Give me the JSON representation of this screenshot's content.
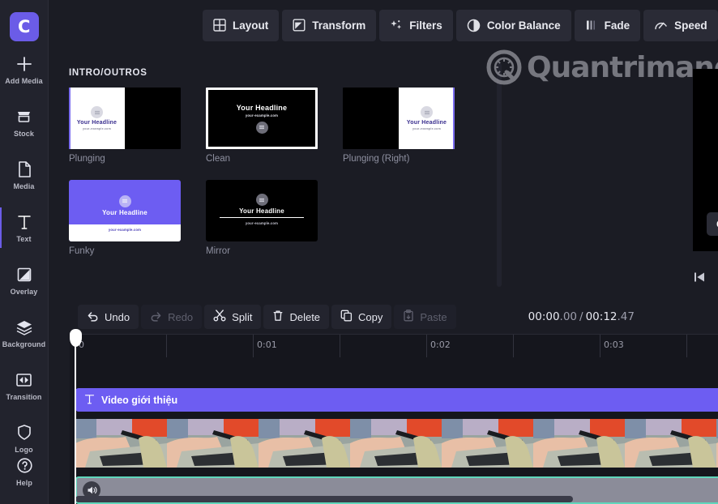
{
  "app": {
    "logo_letter": "C"
  },
  "sidebar": {
    "items": [
      {
        "label": "Add Media",
        "icon": "plus-icon",
        "active": false
      },
      {
        "label": "Stock",
        "icon": "stock-icon",
        "active": false
      },
      {
        "label": "Media",
        "icon": "media-file-icon",
        "active": false
      },
      {
        "label": "Text",
        "icon": "text-t-icon",
        "active": true
      },
      {
        "label": "Overlay",
        "icon": "overlay-icon",
        "active": false
      },
      {
        "label": "Background",
        "icon": "layers-icon",
        "active": false
      },
      {
        "label": "Transition",
        "icon": "transition-icon",
        "active": false
      },
      {
        "label": "Logo",
        "icon": "shield-icon",
        "active": false
      }
    ],
    "help": {
      "label": "Help",
      "icon": "question-circle-icon"
    }
  },
  "toolbar": {
    "buttons": [
      {
        "label": "Layout",
        "icon": "layout-grid-icon"
      },
      {
        "label": "Transform",
        "icon": "transform-icon"
      },
      {
        "label": "Filters",
        "icon": "sparkles-icon"
      },
      {
        "label": "Color Balance",
        "icon": "color-balance-icon"
      },
      {
        "label": "Fade",
        "icon": "fade-bars-icon"
      },
      {
        "label": "Speed",
        "icon": "speed-gauge-icon"
      }
    ],
    "volume_icon": "volume-icon"
  },
  "panel": {
    "title": "INTRO/OUTROS",
    "templates": [
      {
        "name": "Plunging",
        "style": "split-left-white",
        "selected": false,
        "headline": "Your Headline",
        "subtext": "your-example.com"
      },
      {
        "name": "Clean",
        "style": "black-centered",
        "selected": true,
        "headline": "Your Headline",
        "subtext": "your-example.com"
      },
      {
        "name": "Plunging (Right)",
        "style": "split-right-white",
        "selected": false,
        "headline": "Your Headline",
        "subtext": "your-example.com"
      },
      {
        "name": "Funky",
        "style": "purple-white",
        "selected": false,
        "headline": "Your Headline",
        "subtext": "your-example.com"
      },
      {
        "name": "Mirror",
        "style": "black-line",
        "selected": false,
        "headline": "Your Headline",
        "subtext": "your-example.com"
      }
    ]
  },
  "preview": {
    "watermark": "Quantrimang",
    "cta_label": "Cli",
    "skip_back_icon": "skip-back-icon"
  },
  "timeline_toolbar": {
    "buttons": [
      {
        "label": "Undo",
        "icon": "undo-icon",
        "disabled": false
      },
      {
        "label": "Redo",
        "icon": "redo-icon",
        "disabled": true
      },
      {
        "label": "Split",
        "icon": "scissors-icon",
        "disabled": false
      },
      {
        "label": "Delete",
        "icon": "trash-icon",
        "disabled": false
      },
      {
        "label": "Copy",
        "icon": "copy-icon",
        "disabled": false
      },
      {
        "label": "Paste",
        "icon": "paste-icon",
        "disabled": true
      }
    ],
    "time_current_main": "00:00",
    "time_current_frac": ".00",
    "time_sep": "/",
    "time_total_main": "00:12",
    "time_total_frac": ".47"
  },
  "timeline": {
    "ruler_labels": [
      "0",
      "0:01",
      "0:02",
      "0:03"
    ],
    "text_clip": {
      "label": "Video giới thiệu",
      "icon": "text-t-icon",
      "color": "#6d5df2"
    },
    "audio_icon": "volume-icon"
  },
  "colors": {
    "accent": "#6b5ce7",
    "clip_purple": "#6d5df2",
    "audio_border": "#5fd6bb",
    "panel_bg": "#1b1c24",
    "sidebar_bg": "#22232d"
  }
}
